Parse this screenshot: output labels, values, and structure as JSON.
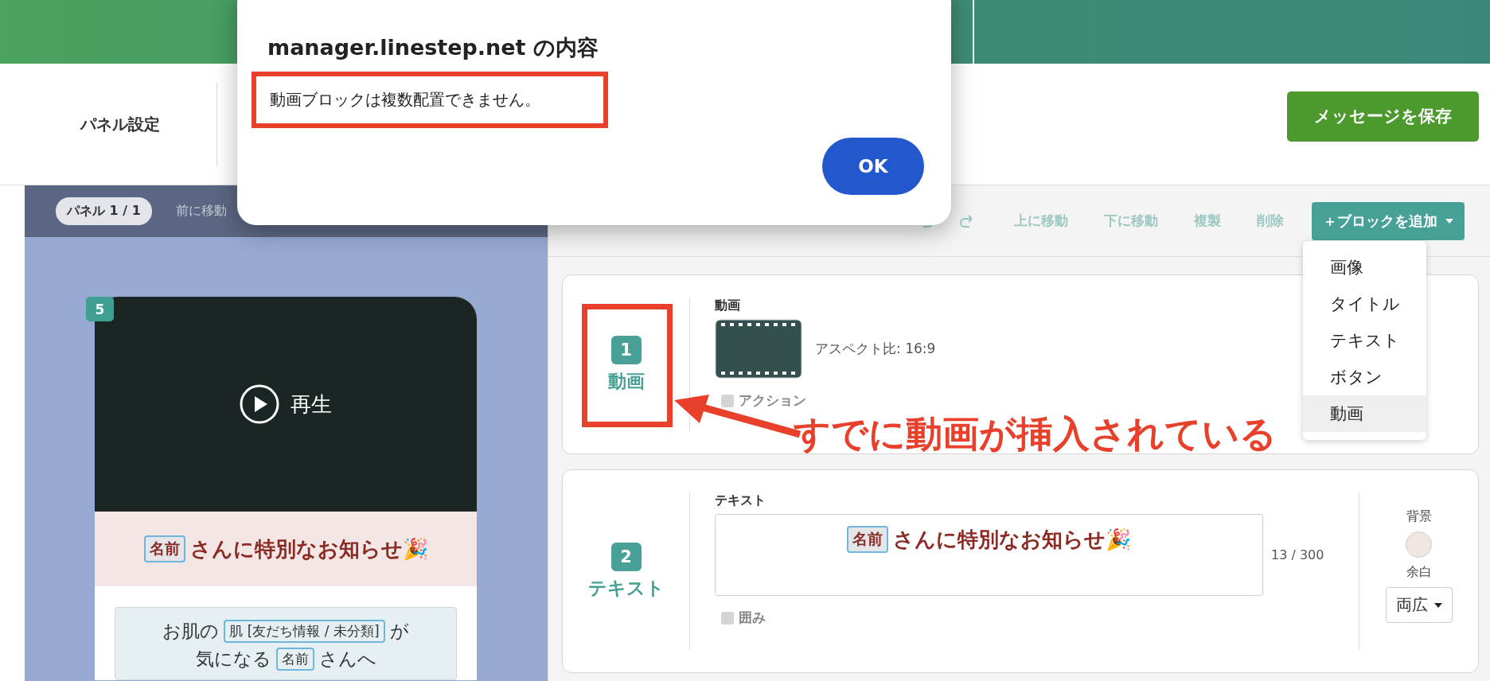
{
  "dialog": {
    "title": "manager.linestep.net の内容",
    "message": "動画ブロックは複数配置できません。",
    "button": "OK"
  },
  "header": {
    "tab": "パネル設定",
    "save_button": "メッセージを保存"
  },
  "preview": {
    "panel_badge": "パネル 1 / 1",
    "move_prev": "前に移動",
    "block_number": "5",
    "play_label": "再生",
    "title": {
      "tag": "名前",
      "text": "さんに特別なお知らせ🎉"
    },
    "message_lines": [
      [
        {
          "kind": "text",
          "text": "お肌の"
        },
        {
          "kind": "tag",
          "text": "肌 [友だち情報 / 未分類]"
        },
        {
          "kind": "text",
          "text": "が"
        }
      ],
      [
        {
          "kind": "text",
          "text": "気になる"
        },
        {
          "kind": "tag",
          "text": "名前"
        },
        {
          "kind": "text",
          "text": "さんへ"
        }
      ]
    ]
  },
  "block_settings": {
    "actions": [
      "上に移動",
      "下に移動",
      "複製",
      "削除"
    ],
    "add_button": "＋ブロックを追加",
    "add_menu": [
      {
        "label": "画像",
        "selected": false
      },
      {
        "label": "タイトル",
        "selected": false
      },
      {
        "label": "テキスト",
        "selected": false
      },
      {
        "label": "ボタン",
        "selected": false
      },
      {
        "label": "動画",
        "selected": true
      }
    ]
  },
  "blocks": [
    {
      "kind": "video",
      "number": "1",
      "type_label": "動画",
      "field_label": "動画",
      "aspect": "アスペクト比: 16:9",
      "option": {
        "label": "アクション",
        "checked": false
      }
    },
    {
      "kind": "text",
      "number": "2",
      "type_label": "テキスト",
      "field_label": "テキスト",
      "content": {
        "tag": "名前",
        "text": "さんに特別なお知らせ🎉"
      },
      "counter": "13 / 300",
      "option": {
        "label": "囲み",
        "checked": false
      },
      "background_label": "背景",
      "margin_label": "余白",
      "margin_value": "両広"
    }
  ],
  "annotation": {
    "text": "すでに動画が挿入されている"
  }
}
